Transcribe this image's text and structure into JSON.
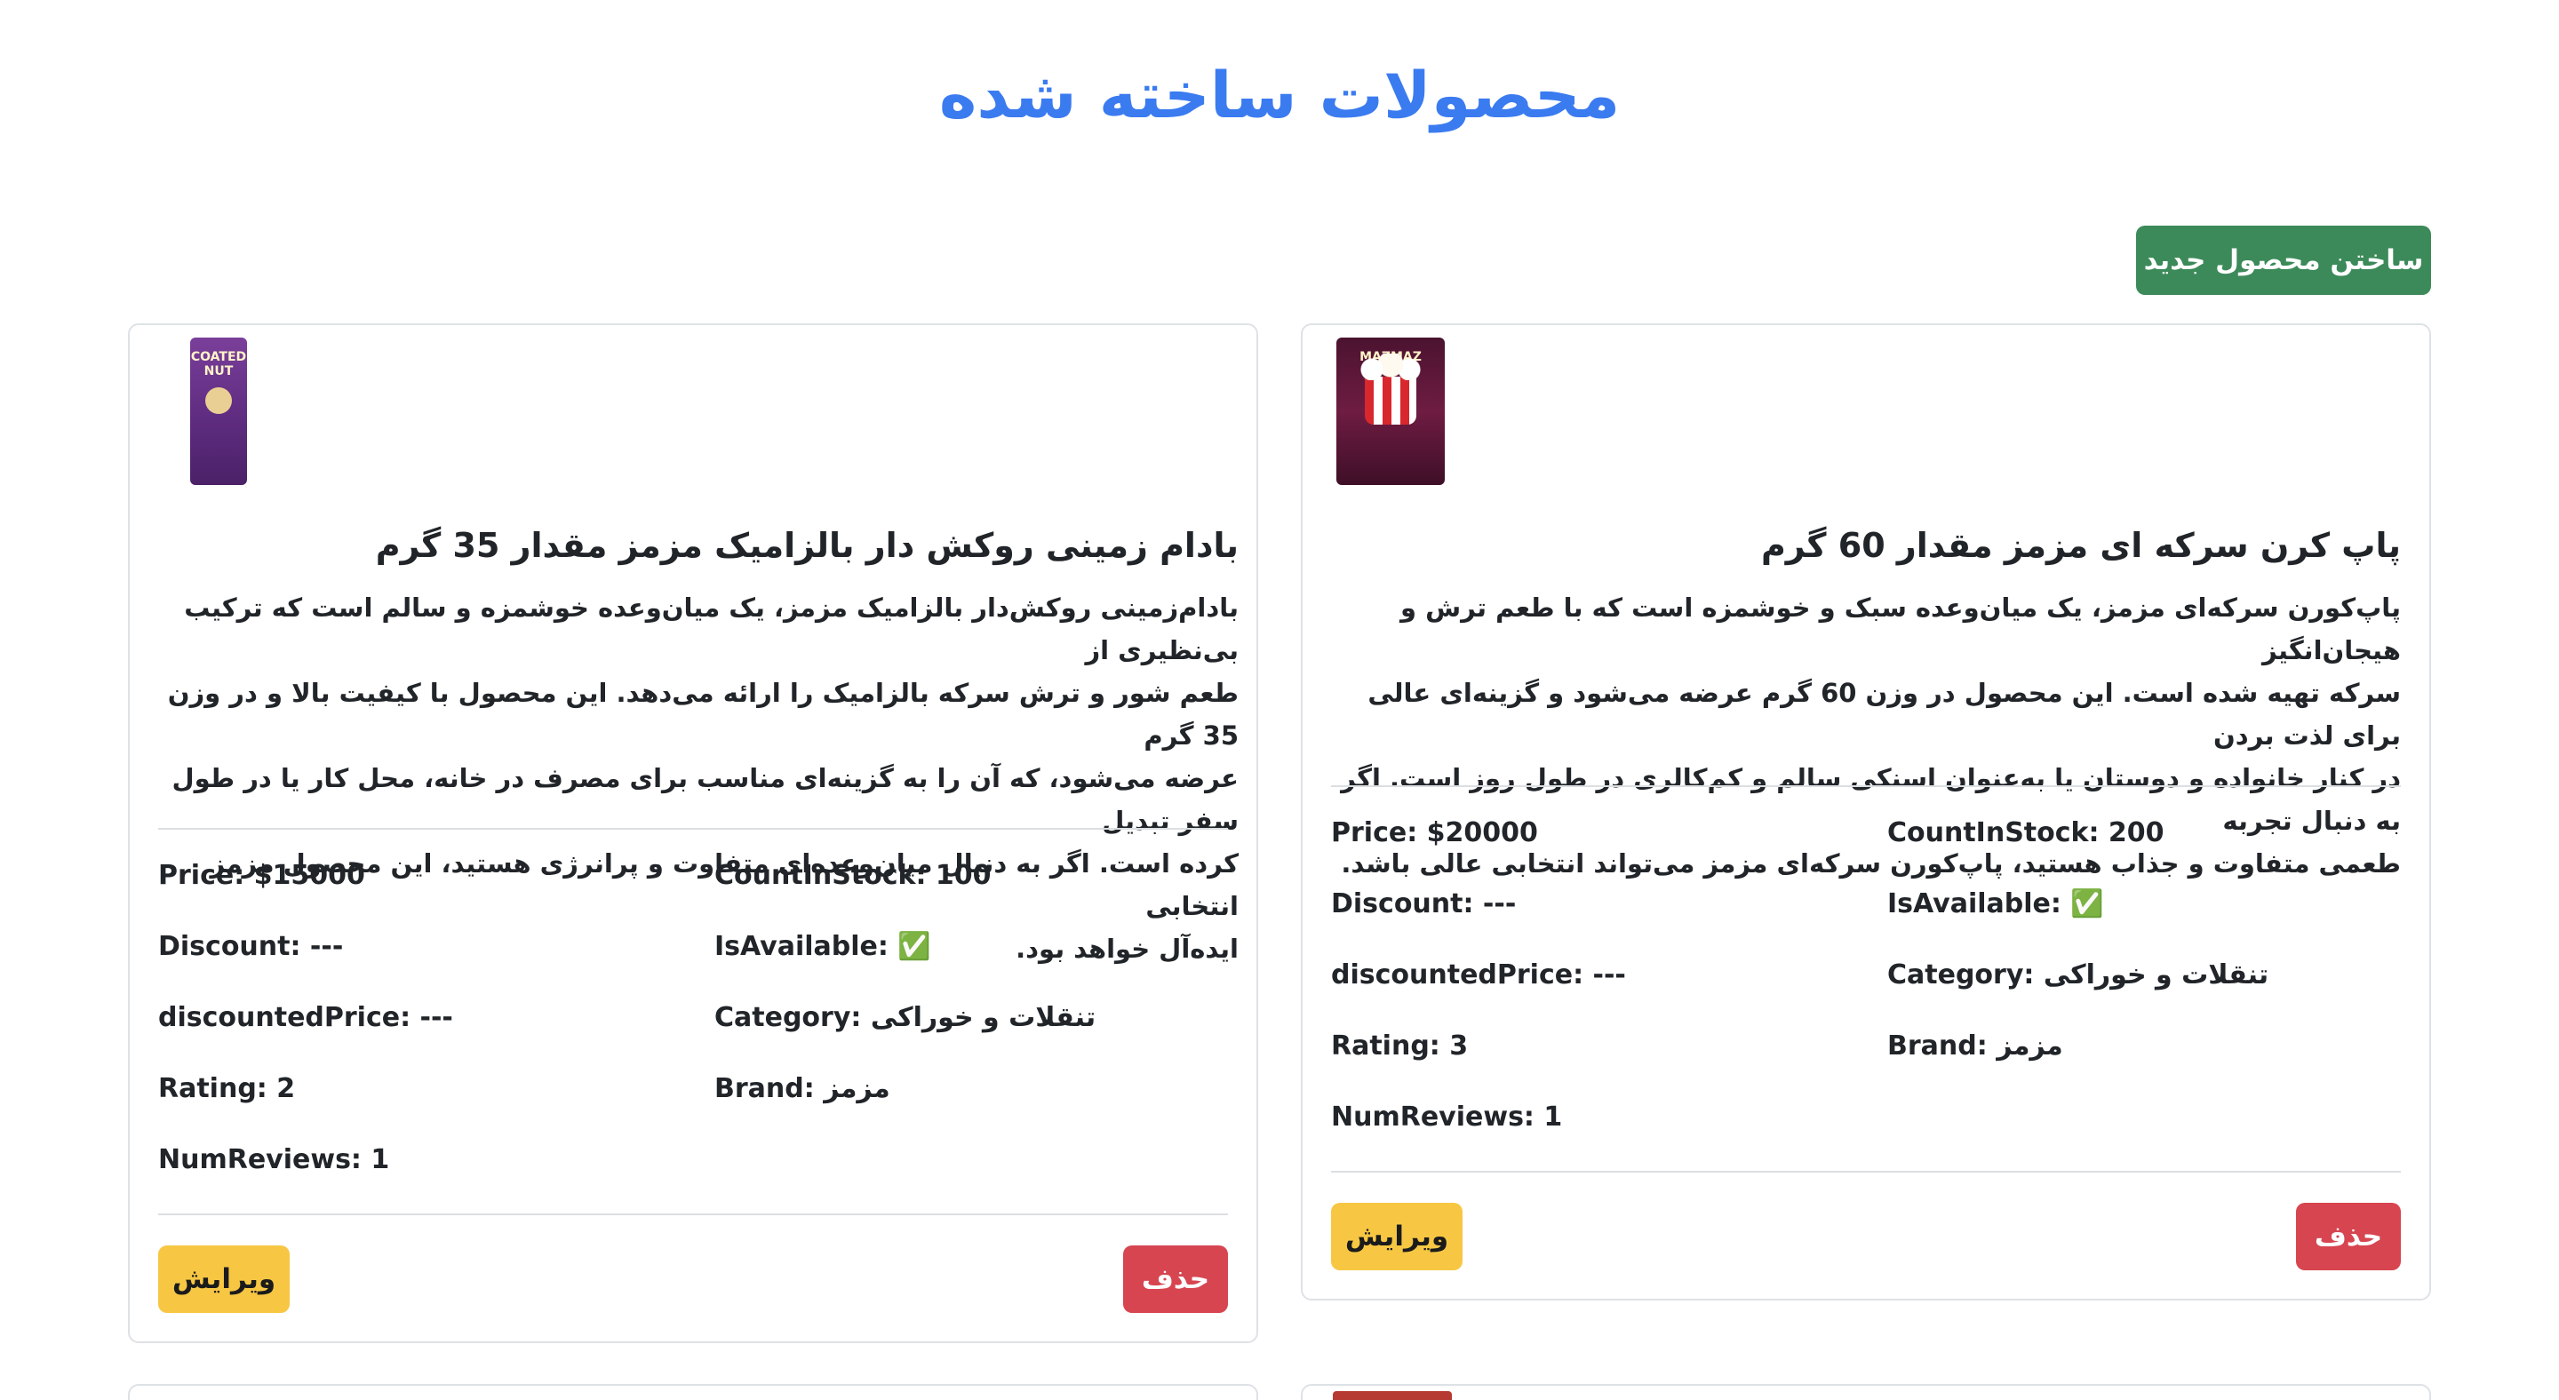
{
  "page": {
    "title": "محصولات ساخته شده",
    "create_button": "ساختن محصول جدید"
  },
  "theme": {
    "title_color": "#3b7bf0",
    "create_color": "#3c8a59",
    "edit_color": "#f7c744",
    "delete_color": "#d64550"
  },
  "products": [
    {
      "title": "بادام زمینی روکش دار بالزامیک مزمز مقدار 35 گرم",
      "image_icon": "coated-peanut-bag-icon",
      "image_text": "COATED NUT",
      "description_lines": [
        "بادام‌زمینی روکش‌دار بالزامیک مزمز، یک میان‌وعده خوشمزه و سالم است که ترکیب بی‌نظیری از",
        "طعم شور و ترش سرکه بالزامیک را ارائه می‌دهد. این محصول با کیفیت بالا و در وزن 35 گرم",
        "عرضه می‌شود، که آن را به گزینه‌ای مناسب برای مصرف در خانه، محل کار یا در طول سفر تبدیل",
        "کرده است. اگر به دنبال میان‌وعده‌ای متفاوت و پرانرژی هستید، این محصول مزمز انتخابی",
        "ایده‌آل خواهد بود."
      ],
      "price": "Price: $15000",
      "count_in_stock": "CountInStock: 100",
      "discount": "Discount: ---",
      "is_available": "IsAvailable: ✅",
      "discounted_price": "discountedPrice: ---",
      "category": "Category: تنقلات و خوراکی",
      "rating": "Rating: 2",
      "brand": "Brand: مزمز",
      "num_reviews": "NumReviews: 1",
      "edit_label": "ویرایش",
      "delete_label": "حذف"
    },
    {
      "title": "پاپ کرن سرکه ای مزمز مقدار 60 گرم",
      "image_icon": "popcorn-bag-icon",
      "image_text": "MAZMAZ",
      "description_lines": [
        "پاپ‌کورن سرکه‌ای مزمز، یک میان‌وعده سبک و خوشمزه است که با طعم ترش و هیجان‌انگیز",
        "سرکه تهیه شده است. این محصول در وزن 60 گرم عرضه می‌شود و گزینه‌ای عالی برای لذت بردن",
        "در کنار خانواده و دوستان یا به‌عنوان اسنکی سالم و کم‌کالری در طول روز است. اگر به دنبال تجربه",
        "طعمی متفاوت و جذاب هستید، پاپ‌کورن سرکه‌ای مزمز می‌تواند انتخابی عالی باشد."
      ],
      "price": "Price: $20000",
      "count_in_stock": "CountInStock: 200",
      "discount": "Discount: ---",
      "is_available": "IsAvailable: ✅",
      "discounted_price": "discountedPrice: ---",
      "category": "Category: تنقلات و خوراکی",
      "rating": "Rating: 3",
      "brand": "Brand: مزمز",
      "num_reviews": "NumReviews: 1",
      "edit_label": "ویرایش",
      "delete_label": "حذف"
    }
  ]
}
